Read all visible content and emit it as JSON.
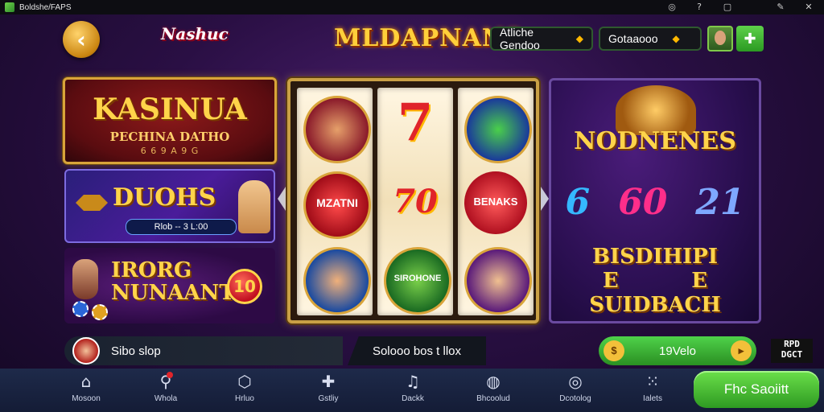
{
  "window": {
    "title": "Boldshe/FAPS"
  },
  "header": {
    "logo_left": "Nashuc",
    "title": "MLDAPNANS",
    "pill_left": {
      "label": "Atliche Gendoo"
    },
    "pill_right": {
      "label": "Gotaaooo"
    }
  },
  "banners": {
    "top": {
      "title": "KASINUA",
      "subtitle": "PECHINA DATHO",
      "small": "6 6 9 A 9 G"
    },
    "mid": {
      "title": "DUOHS",
      "bar": "Rlob -- 3 L:00"
    },
    "bottom": {
      "title_line1": "IRORG",
      "title_line2": "NUNAANT",
      "ball": "10"
    }
  },
  "reels": {
    "symbols": [
      [
        "",
        "MZATNI",
        ""
      ],
      [
        "7",
        "70",
        "SIROHONE"
      ],
      [
        "",
        "BENAKS",
        ""
      ]
    ]
  },
  "right_panel": {
    "title": "NODNENES",
    "numbers": [
      "6",
      "60",
      "21"
    ],
    "number_colors": [
      "#35b8ff",
      "#ff2e8a",
      "#7ea8ff"
    ],
    "subtitle_line1": "BISDIHIPI",
    "subtitle_line2": "E          E",
    "subtitle_line3": "SUIDBACH"
  },
  "status": {
    "left": "Sibo slop",
    "mid": "Solooo bos t llox",
    "right_value": "19Velo"
  },
  "brand_right": {
    "line1": "RPD",
    "line2": "DGCT"
  },
  "nav": {
    "items": [
      {
        "label": "Mosoon",
        "icon": "home-icon",
        "glyph": "⌂"
      },
      {
        "label": "Whola",
        "icon": "search-icon",
        "glyph": "⚲"
      },
      {
        "label": "Hrluo",
        "icon": "box-icon",
        "glyph": "⬡"
      },
      {
        "label": "Gstliy",
        "icon": "puzzle-icon",
        "glyph": "✚"
      },
      {
        "label": "Dackk",
        "icon": "music-note-icon",
        "glyph": "♫"
      },
      {
        "label": "Bhcoolud",
        "icon": "globe-icon",
        "glyph": "◍"
      },
      {
        "label": "Dcotolog",
        "icon": "target-icon",
        "glyph": "◎"
      },
      {
        "label": "Ialets",
        "icon": "grid-icon",
        "glyph": "⁙"
      }
    ],
    "cta": "Fhc Saoiitt"
  }
}
